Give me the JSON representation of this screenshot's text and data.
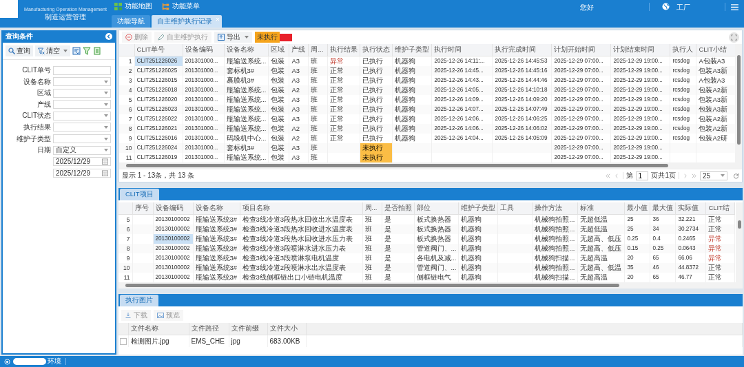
{
  "header": {
    "subtitle": "Manufacturing Operation Management",
    "app_name": "制造运营管理",
    "nav": [
      "功能地图",
      "功能菜单"
    ],
    "tabs": [
      {
        "label": "功能导航",
        "selected": false,
        "closable": false
      },
      {
        "label": "自主维护执行记录",
        "selected": true,
        "closable": true
      }
    ],
    "greeting": "您好",
    "factory": "工厂"
  },
  "query_panel": {
    "title": "查询条件",
    "buttons": [
      {
        "label": "查询",
        "kind": "search"
      },
      {
        "label": "清空",
        "kind": "clear"
      }
    ],
    "fields": [
      {
        "label": "CLIT单号",
        "kind": "text"
      },
      {
        "label": "设备名称",
        "kind": "select"
      },
      {
        "label": "区域",
        "kind": "select"
      },
      {
        "label": "产线",
        "kind": "select"
      },
      {
        "label": "CLIT状态",
        "kind": "select"
      },
      {
        "label": "执行结果",
        "kind": "select"
      },
      {
        "label": "维护子类型",
        "kind": "select"
      },
      {
        "label": "日期",
        "kind": "select",
        "value": "自定义"
      },
      {
        "kind": "date",
        "value": "2025/12/29"
      },
      {
        "kind": "date",
        "value": "2025/12/29"
      }
    ]
  },
  "records": {
    "toolbar": [
      {
        "label": "删除",
        "kind": "delete",
        "disabled": true
      },
      {
        "label": "自主维护执行",
        "kind": "edit",
        "disabled": true
      },
      {
        "label": "导出",
        "kind": "export",
        "disabled": false
      }
    ],
    "legend": [
      {
        "label": "未执行",
        "color": "#f5a41c"
      },
      {
        "color": "#e8202a"
      }
    ],
    "columns": [
      {
        "label": "CLIT单号"
      },
      {
        "label": "设备编码"
      },
      {
        "label": "设备名称"
      },
      {
        "label": "区域"
      },
      {
        "label": "产线"
      },
      {
        "label": "周..."
      },
      {
        "label": "执行结果",
        "kind": "result"
      },
      {
        "label": "执行状态",
        "kind": "status"
      },
      {
        "label": "维护子类型"
      },
      {
        "label": "执行时间"
      },
      {
        "label": "执行完成时间"
      },
      {
        "label": "计划开始时间"
      },
      {
        "label": "计划结束时间"
      },
      {
        "label": "执行人"
      },
      {
        "label": "CLIT小结"
      }
    ],
    "rows": [
      {
        "n": "1",
        "selected": true,
        "result_abnormal": true,
        "status_pending": false,
        "cells": [
          "CLIT251226026",
          "201301000...",
          "瓶输送系统...",
          "包装",
          "A3",
          "班",
          "异常",
          "已执行",
          "机器狗",
          "2025-12-26 14:11:...",
          "2025-12-26 14:45:53",
          "2025-12-29 07:00...",
          "2025-12-29 19:00...",
          "rcsdog",
          "A包装A3"
        ]
      },
      {
        "n": "2",
        "selected": false,
        "result_abnormal": false,
        "status_pending": false,
        "cells": [
          "CLIT251226025",
          "201301000...",
          "套标机3#",
          "包装",
          "A3",
          "班",
          "正常",
          "已执行",
          "机器狗",
          "2025-12-26 14:45...",
          "2025-12-26 14:45:16",
          "2025-12-29 07:00...",
          "2025-12-29 19:00...",
          "rcsdog",
          "包装A3新"
        ]
      },
      {
        "n": "3",
        "selected": false,
        "result_abnormal": false,
        "status_pending": false,
        "cells": [
          "CLIT251226015",
          "201301000...",
          "裹膜机3#",
          "包装",
          "A3",
          "班",
          "正常",
          "已执行",
          "机器狗",
          "2025-12-26 14:43...",
          "2025-12-26 14:44:46",
          "2025-12-29 07:00...",
          "2025-12-29 19:00...",
          "rcsdog",
          "A包装A3"
        ]
      },
      {
        "n": "4",
        "selected": false,
        "result_abnormal": false,
        "status_pending": false,
        "cells": [
          "CLIT251226018",
          "201301000...",
          "瓶输送系统...",
          "包装",
          "A2",
          "班",
          "正常",
          "已执行",
          "机器狗",
          "2025-12-26 14:05...",
          "2025-12-26 14:10:18",
          "2025-12-29 07:00...",
          "2025-12-29 19:00...",
          "rcsdog",
          "包装A2新"
        ]
      },
      {
        "n": "5",
        "selected": false,
        "result_abnormal": false,
        "status_pending": false,
        "cells": [
          "CLIT251226020",
          "201301000...",
          "瓶输送系统...",
          "包装",
          "A3",
          "班",
          "正常",
          "已执行",
          "机器狗",
          "2025-12-26 14:09...",
          "2025-12-26 14:09:20",
          "2025-12-29 07:00...",
          "2025-12-29 19:00...",
          "rcsdog",
          "包装A3新"
        ]
      },
      {
        "n": "6",
        "selected": false,
        "result_abnormal": false,
        "status_pending": false,
        "cells": [
          "CLIT251226023",
          "201301000...",
          "瓶输送系统...",
          "包装",
          "A3",
          "班",
          "正常",
          "已执行",
          "机器狗",
          "2025-12-26 14:07...",
          "2025-12-26 14:07:49",
          "2025-12-29 07:00...",
          "2025-12-29 19:00...",
          "rcsdog",
          "包装A3新"
        ]
      },
      {
        "n": "7",
        "selected": false,
        "result_abnormal": false,
        "status_pending": false,
        "cells": [
          "CLIT251226022",
          "201301000...",
          "瓶输送系统...",
          "包装",
          "A3",
          "班",
          "正常",
          "已执行",
          "机器狗",
          "2025-12-26 14:06...",
          "2025-12-26 14:06:25",
          "2025-12-29 07:00...",
          "2025-12-29 19:00...",
          "rcsdog",
          "包装A2新"
        ]
      },
      {
        "n": "8",
        "selected": false,
        "result_abnormal": false,
        "status_pending": false,
        "cells": [
          "CLIT251226021",
          "201301000...",
          "瓶输送系统...",
          "包装",
          "A2",
          "班",
          "正常",
          "已执行",
          "机器狗",
          "2025-12-26 14:06...",
          "2025-12-26 14:06:02",
          "2025-12-29 07:00...",
          "2025-12-29 19:00...",
          "rcsdog",
          "包装A2新"
        ]
      },
      {
        "n": "9",
        "selected": false,
        "result_abnormal": false,
        "status_pending": false,
        "cells": [
          "CLIT251226016",
          "201301000...",
          "码垛机中心...",
          "包装",
          "A2",
          "班",
          "正常",
          "已执行",
          "机器狗",
          "2025-12-26 14:04...",
          "2025-12-26 14:05:09",
          "2025-12-29 07:00...",
          "2025-12-29 19:00...",
          "rcsdog",
          "包装A2研"
        ]
      },
      {
        "n": "10",
        "selected": false,
        "result_abnormal": false,
        "status_pending": true,
        "cells": [
          "CLIT251226024",
          "201301000...",
          "套标机3#",
          "包装",
          "A3",
          "班",
          null,
          "未执行",
          null,
          null,
          null,
          "2025-12-29 07:00...",
          "2025-12-29 19:00...",
          null,
          null
        ]
      },
      {
        "n": "11",
        "selected": false,
        "result_abnormal": false,
        "status_pending": true,
        "cells": [
          "CLIT251226019",
          "201301000...",
          "瓶输送系统...",
          "包装",
          "A3",
          "班",
          null,
          "未执行",
          null,
          null,
          null,
          "2025-12-29 07:00...",
          "2025-12-29 19:00...",
          null,
          null
        ]
      }
    ],
    "pager": {
      "summary": "显示 1 - 13条，共 13 条",
      "page_label": "第",
      "page": "1",
      "page_total": "页共1页",
      "page_size": "25"
    }
  },
  "items": {
    "title": "CLIT项目",
    "columns": [
      {
        "label": "序号"
      },
      {
        "label": "设备编码"
      },
      {
        "label": "设备名称"
      },
      {
        "label": "项目名称"
      },
      {
        "label": "周..."
      },
      {
        "label": "是否拍照"
      },
      {
        "label": "部位"
      },
      {
        "label": "维护子类型"
      },
      {
        "label": "工具"
      },
      {
        "label": "操作方法"
      },
      {
        "label": "标准"
      },
      {
        "label": "最小值"
      },
      {
        "label": "最大值"
      },
      {
        "label": "实际值"
      },
      {
        "label": "CLIT结",
        "kind": "result"
      }
    ],
    "rows": [
      {
        "n": "5",
        "selected": false,
        "abnormal": false,
        "cells": [
          null,
          "20130100002",
          "瓶输送系统3#",
          "检查3线冷道3段热水回收出水温度表",
          "班",
          "是",
          "板式换热器",
          "机器狗",
          null,
          "机械狗拍照...",
          "无超低温",
          "25",
          "36",
          "32.221",
          "正常"
        ]
      },
      {
        "n": "6",
        "selected": false,
        "abnormal": false,
        "cells": [
          null,
          "20130100002",
          "瓶输送系统3#",
          "检查3线冷道3段热水回收进水温度表",
          "班",
          "是",
          "板式换热器",
          "机器狗",
          null,
          "机械狗拍照...",
          "无超低温",
          "25",
          "34",
          "30.2734",
          "正常"
        ]
      },
      {
        "n": "7",
        "selected": true,
        "abnormal": true,
        "cells": [
          null,
          "20130100002",
          "瓶输送系统3#",
          "检查3线冷道3段热水回收进水压力表",
          "班",
          "是",
          "板式换热器",
          "机器狗",
          null,
          "机械狗拍照...",
          "无超高、低压",
          "0.25",
          "0.4",
          "0.2465",
          "异常"
        ]
      },
      {
        "n": "8",
        "selected": false,
        "abnormal": true,
        "cells": [
          null,
          "20130100002",
          "瓶输送系统3#",
          "检查3线冷道3段喷淋水进水压力表",
          "班",
          "是",
          "管道阀门、...",
          "机器狗",
          null,
          "机械狗拍照...",
          "无超高、低压",
          "0.15",
          "0.25",
          "0.0643",
          "异常"
        ]
      },
      {
        "n": "9",
        "selected": false,
        "abnormal": true,
        "cells": [
          null,
          "20130100002",
          "瓶输送系统3#",
          "检查3线冷道3段喷淋泵电机温度",
          "班",
          "是",
          "各电机及减...",
          "机器狗",
          null,
          "机械狗扫描...",
          "无超高温",
          "20",
          "65",
          "66.06",
          "异常"
        ]
      },
      {
        "n": "10",
        "selected": false,
        "abnormal": false,
        "cells": [
          null,
          "20130100002",
          "瓶输送系统3#",
          "检查3线冷道2段喷淋水出水温度表",
          "班",
          "是",
          "管道阀门、...",
          "机器狗",
          null,
          "机械狗拍照...",
          "无超高、低温",
          "35",
          "46",
          "44.8372",
          "正常"
        ]
      },
      {
        "n": "11",
        "selected": false,
        "abnormal": false,
        "cells": [
          null,
          "20130100002",
          "瓶输送系统3#",
          "检查3线侧框链出口小链电机温度",
          "班",
          "是",
          "侧框链电气",
          "机器狗",
          null,
          "机械狗扫描...",
          "无超高温",
          "20",
          "65",
          "46.77",
          "正常"
        ]
      }
    ]
  },
  "photos": {
    "title": "执行图片",
    "toolbar": [
      {
        "label": "下载",
        "kind": "download",
        "disabled": true
      },
      {
        "label": "预览",
        "kind": "preview",
        "disabled": true
      }
    ],
    "columns": [
      "文件名称",
      "文件路径",
      "文件前缀",
      "文件大小"
    ],
    "rows": [
      {
        "checked": false,
        "cells": [
          "检测图片.jpg",
          "EMS_CHE",
          "jpg",
          "683.00KB"
        ]
      }
    ]
  },
  "status_bar": {
    "text": "环境"
  }
}
